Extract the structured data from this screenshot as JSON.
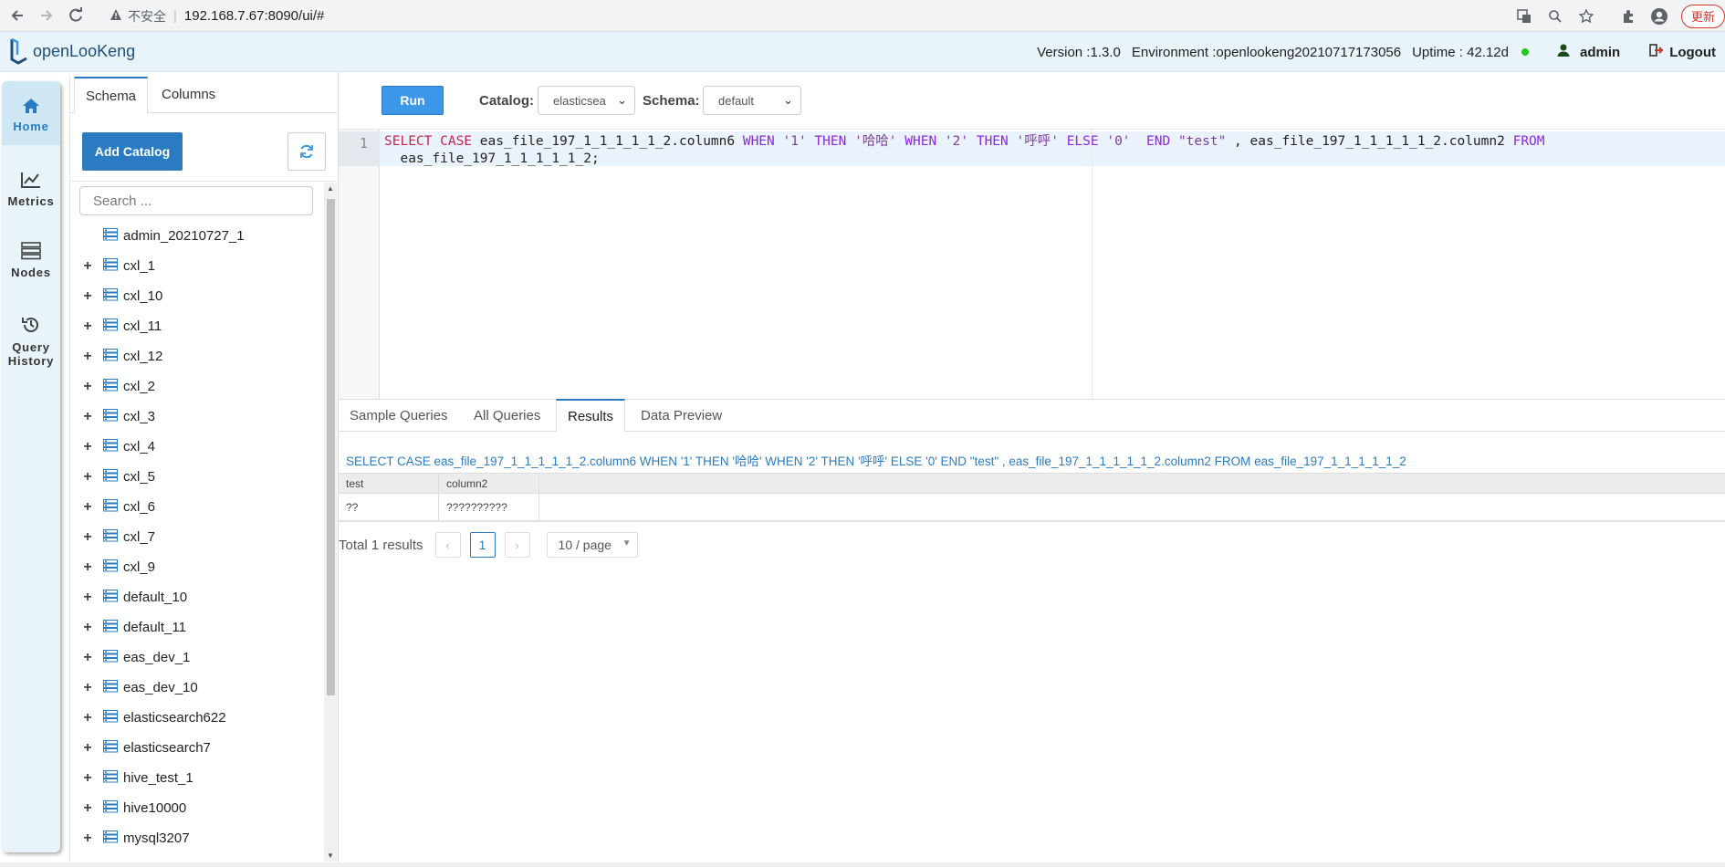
{
  "browser": {
    "insecure_label": "不安全",
    "url": "192.168.7.67:8090/ui/#",
    "update_label": "更新"
  },
  "header": {
    "logo_text": "openLooKeng",
    "version": "Version :1.3.0",
    "environment": "Environment :openlookeng20210717173056",
    "uptime": "Uptime : 42.12d",
    "status_color": "#1ec81e",
    "user": "admin",
    "logout": "Logout"
  },
  "nav": {
    "home": "Home",
    "metrics": "Metrics",
    "nodes": "Nodes",
    "query": "Query",
    "history": "History"
  },
  "schema_panel": {
    "tabs": [
      "Schema",
      "Columns"
    ],
    "add_catalog": "Add Catalog",
    "search_placeholder": "Search ...",
    "catalogs": [
      {
        "name": "admin_20210727_1",
        "expandable": false
      },
      {
        "name": "cxl_1",
        "expandable": true
      },
      {
        "name": "cxl_10",
        "expandable": true
      },
      {
        "name": "cxl_11",
        "expandable": true
      },
      {
        "name": "cxl_12",
        "expandable": true
      },
      {
        "name": "cxl_2",
        "expandable": true
      },
      {
        "name": "cxl_3",
        "expandable": true
      },
      {
        "name": "cxl_4",
        "expandable": true
      },
      {
        "name": "cxl_5",
        "expandable": true
      },
      {
        "name": "cxl_6",
        "expandable": true
      },
      {
        "name": "cxl_7",
        "expandable": true
      },
      {
        "name": "cxl_9",
        "expandable": true
      },
      {
        "name": "default_10",
        "expandable": true
      },
      {
        "name": "default_11",
        "expandable": true
      },
      {
        "name": "eas_dev_1",
        "expandable": true
      },
      {
        "name": "eas_dev_10",
        "expandable": true
      },
      {
        "name": "elasticsearch622",
        "expandable": true
      },
      {
        "name": "elasticsearch7",
        "expandable": true
      },
      {
        "name": "hive_test_1",
        "expandable": true
      },
      {
        "name": "hive10000",
        "expandable": true
      },
      {
        "name": "mysql3207",
        "expandable": true
      }
    ]
  },
  "toolbar": {
    "run_label": "Run",
    "catalog_label": "Catalog:",
    "catalog_value": "elasticsea",
    "schema_label": "Schema:",
    "schema_value": "default"
  },
  "editor": {
    "line_number": "1",
    "line1": {
      "t1": "SELECT CASE",
      "t2": " eas_file_197_1_1_1_1_1_2.column6 ",
      "t3": "WHEN",
      "t4": " '1' ",
      "t5": "THEN",
      "t6": " '哈哈' ",
      "t7": "WHEN",
      "t8": " '2' ",
      "t9": "THEN",
      "t10": " '呼呼' ",
      "t11": "ELSE",
      "t12": " '0'  ",
      "t13": "END",
      "t14": " \"test\"",
      "t15": " , eas_file_197_1_1_1_1_1_2.column2 ",
      "t16": "FROM"
    },
    "line2": "  eas_file_197_1_1_1_1_1_2;"
  },
  "results": {
    "tabs": [
      "Sample Queries",
      "All Queries",
      "Results",
      "Data Preview"
    ],
    "query_text": "SELECT CASE eas_file_197_1_1_1_1_1_2.column6 WHEN '1' THEN '哈哈' WHEN '2' THEN '呼呼' ELSE '0' END \"test\" , eas_file_197_1_1_1_1_1_2.column2 FROM eas_file_197_1_1_1_1_1_2",
    "columns": [
      "test",
      "column2"
    ],
    "rows": [
      [
        "??",
        "??????????"
      ]
    ],
    "total": "Total 1 results",
    "prev": "‹",
    "page": "1",
    "next": "›",
    "page_size": "10 / page"
  }
}
